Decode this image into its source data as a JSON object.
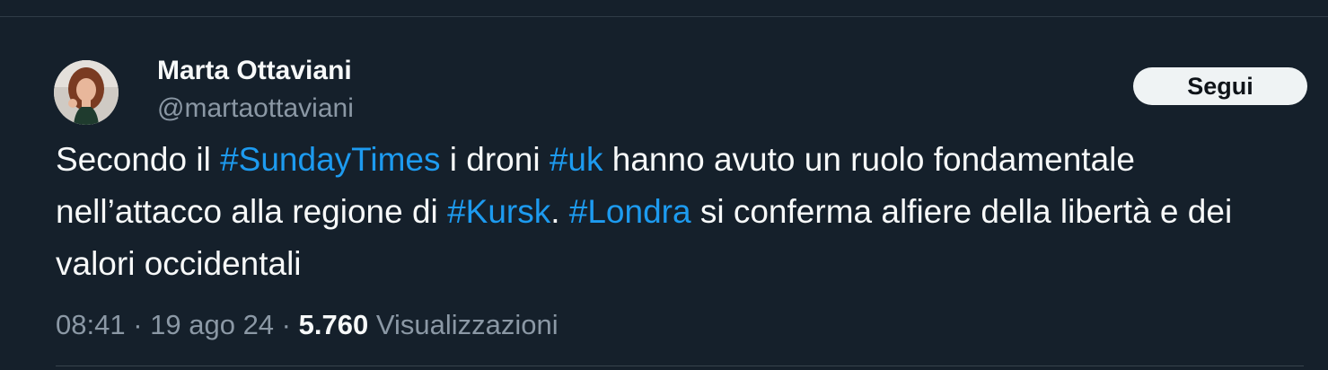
{
  "author": {
    "display_name": "Marta Ottaviani",
    "handle": "@martaottaviani",
    "avatar_icon": "profile-photo"
  },
  "follow_button": {
    "label": "Segui"
  },
  "tweet": {
    "segments": [
      {
        "text": "Secondo il ",
        "type": "text"
      },
      {
        "text": "#SundayTimes",
        "type": "hashtag"
      },
      {
        "text": " i droni ",
        "type": "text"
      },
      {
        "text": "#uk",
        "type": "hashtag"
      },
      {
        "text": " hanno avuto un ruolo fondamentale nell’attacco alla regione di ",
        "type": "text"
      },
      {
        "text": "#Kursk",
        "type": "hashtag"
      },
      {
        "text": ". ",
        "type": "text"
      },
      {
        "text": "#Londra",
        "type": "hashtag"
      },
      {
        "text": " si conferma alfiere della libertà e dei valori occidentali",
        "type": "text"
      }
    ]
  },
  "meta": {
    "time": "08:41",
    "separator": " · ",
    "date": "19 ago 24",
    "views_count": "5.760",
    "views_label": "Visualizzazioni"
  },
  "colors": {
    "background": "#15202b",
    "hashtag": "#1d9bf0",
    "secondary_text": "#8b98a5",
    "primary_text": "#f7f9f9"
  }
}
